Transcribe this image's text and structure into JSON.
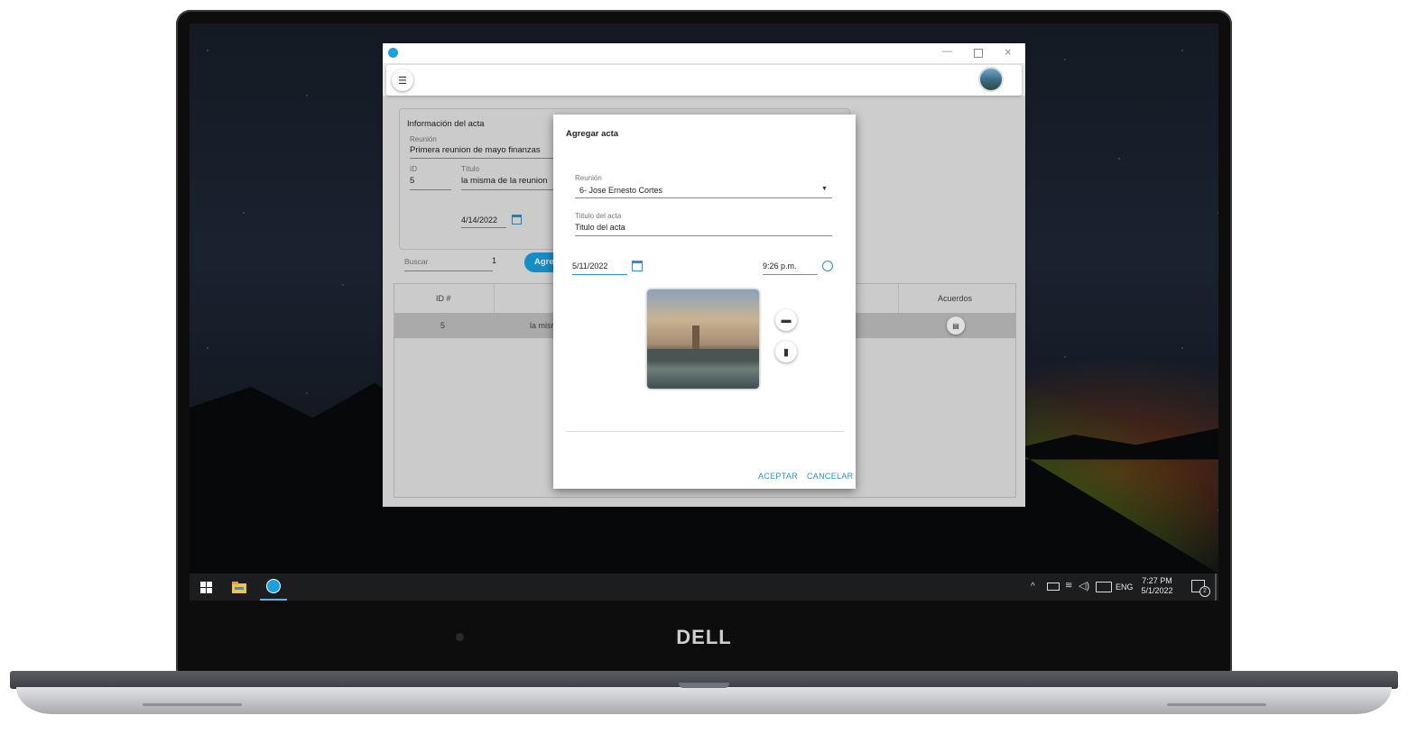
{
  "app": {
    "card_title": "Información del acta",
    "reunion_label": "Reunión",
    "reunion_value": "Primera reunion de mayo finanzas",
    "id_label": "ID",
    "id_value": "5",
    "titulo_label": "Título",
    "titulo_value": "la misma de la reunion",
    "date_value": "4/14/2022",
    "search_placeholder": "Buscar",
    "search_count": "1",
    "add_button_partial": "Agre",
    "grid": {
      "headers": [
        "ID #",
        "Acuerdos"
      ],
      "rows": [
        {
          "id": "5",
          "titulo": "la misr"
        }
      ]
    }
  },
  "dialog": {
    "title": "Agregar acta",
    "reunion_label": "Reunión",
    "reunion_value": "6- Jose Ernesto Cortes",
    "titulo_label": "Tiitulo del acta",
    "titulo_value": "Titulo del acta",
    "date_value": "5/11/2022",
    "time_value": "9:26 p.m.",
    "accept_label": "ACEPTAR",
    "cancel_label": "CANCELAR"
  },
  "taskbar": {
    "lang": "ENG",
    "time": "7:27 PM",
    "date": "5/1/2022",
    "notif_count": "2"
  },
  "brand": "DELL",
  "colors": {
    "accent": "#1aa1e0",
    "link": "#2f8fc4",
    "selected_row": "#c2c2c2"
  }
}
